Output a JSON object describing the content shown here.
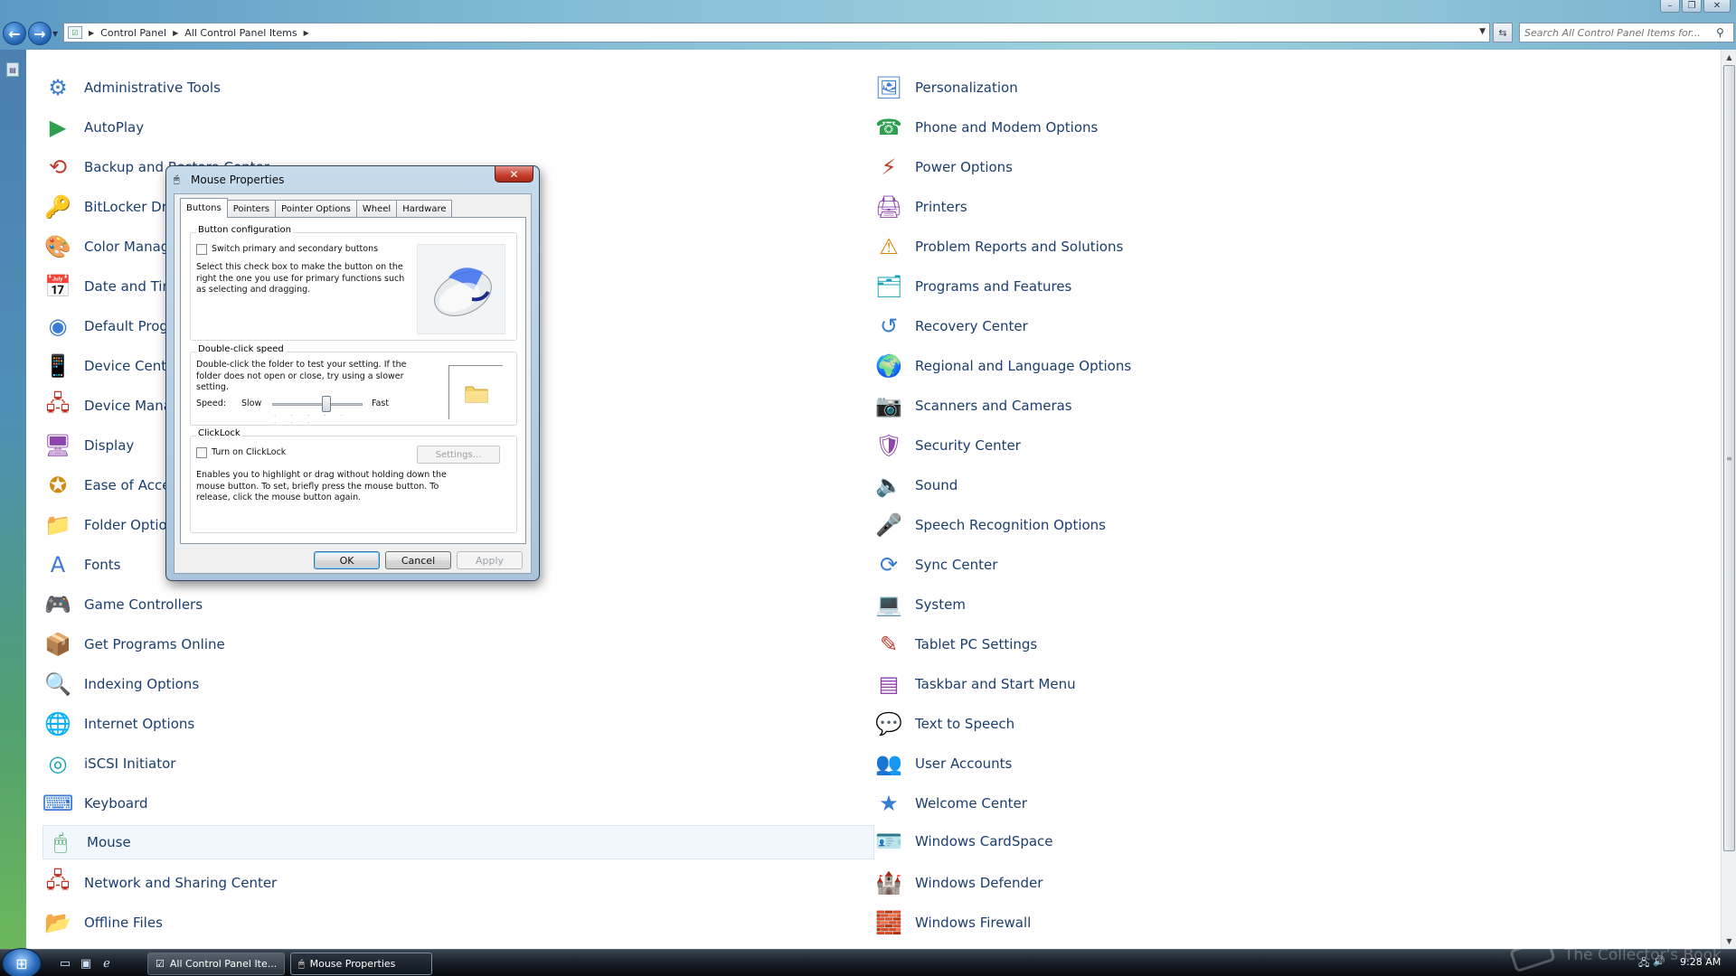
{
  "window": {
    "controls": [
      "minimize",
      "maximize",
      "close"
    ]
  },
  "address_bar": {
    "breadcrumbs": [
      "Control Panel",
      "All Control Panel Items"
    ],
    "search_placeholder": "Search All Control Panel Items for..."
  },
  "control_panel": {
    "left_column": [
      {
        "label": "Administrative Tools",
        "icon": "admin-tools-icon"
      },
      {
        "label": "AutoPlay",
        "icon": "autoplay-icon"
      },
      {
        "label": "Backup and Restore Center",
        "icon": "backup-icon"
      },
      {
        "label": "BitLocker Drive Encryption",
        "icon": "bitlocker-icon"
      },
      {
        "label": "Color Management",
        "icon": "color-management-icon"
      },
      {
        "label": "Date and Time",
        "icon": "date-time-icon"
      },
      {
        "label": "Default Programs",
        "icon": "default-programs-icon"
      },
      {
        "label": "Device Center",
        "icon": "device-center-icon"
      },
      {
        "label": "Device Manager",
        "icon": "device-manager-icon"
      },
      {
        "label": "Display",
        "icon": "display-icon"
      },
      {
        "label": "Ease of Access Center",
        "icon": "ease-of-access-icon"
      },
      {
        "label": "Folder Options",
        "icon": "folder-options-icon"
      },
      {
        "label": "Fonts",
        "icon": "fonts-icon"
      },
      {
        "label": "Game Controllers",
        "icon": "game-controllers-icon"
      },
      {
        "label": "Get Programs Online",
        "icon": "get-programs-icon"
      },
      {
        "label": "Indexing Options",
        "icon": "indexing-icon"
      },
      {
        "label": "Internet Options",
        "icon": "internet-options-icon"
      },
      {
        "label": "iSCSI Initiator",
        "icon": "iscsi-icon"
      },
      {
        "label": "Keyboard",
        "icon": "keyboard-icon"
      },
      {
        "label": "Mouse",
        "icon": "mouse-icon",
        "selected": true
      },
      {
        "label": "Network and Sharing Center",
        "icon": "network-icon"
      },
      {
        "label": "Offline Files",
        "icon": "offline-files-icon"
      }
    ],
    "right_column": [
      {
        "label": "Personalization",
        "icon": "personalization-icon"
      },
      {
        "label": "Phone and Modem Options",
        "icon": "phone-modem-icon"
      },
      {
        "label": "Power Options",
        "icon": "power-options-icon"
      },
      {
        "label": "Printers",
        "icon": "printers-icon"
      },
      {
        "label": "Problem Reports and Solutions",
        "icon": "problem-reports-icon"
      },
      {
        "label": "Programs and Features",
        "icon": "programs-features-icon"
      },
      {
        "label": "Recovery Center",
        "icon": "recovery-icon"
      },
      {
        "label": "Regional and Language Options",
        "icon": "regional-icon"
      },
      {
        "label": "Scanners and Cameras",
        "icon": "scanners-icon"
      },
      {
        "label": "Security Center",
        "icon": "security-center-icon"
      },
      {
        "label": "Sound",
        "icon": "sound-icon"
      },
      {
        "label": "Speech Recognition Options",
        "icon": "speech-recognition-icon"
      },
      {
        "label": "Sync Center",
        "icon": "sync-center-icon"
      },
      {
        "label": "System",
        "icon": "system-icon"
      },
      {
        "label": "Tablet PC Settings",
        "icon": "tablet-pc-icon"
      },
      {
        "label": "Taskbar and Start Menu",
        "icon": "taskbar-icon"
      },
      {
        "label": "Text to Speech",
        "icon": "text-to-speech-icon"
      },
      {
        "label": "User Accounts",
        "icon": "user-accounts-icon"
      },
      {
        "label": "Welcome Center",
        "icon": "welcome-center-icon"
      },
      {
        "label": "Windows CardSpace",
        "icon": "cardspace-icon"
      },
      {
        "label": "Windows Defender",
        "icon": "defender-icon"
      },
      {
        "label": "Windows Firewall",
        "icon": "firewall-icon"
      }
    ]
  },
  "dialog": {
    "title": "Mouse Properties",
    "tabs": [
      "Buttons",
      "Pointers",
      "Pointer Options",
      "Wheel",
      "Hardware"
    ],
    "active_tab": "Buttons",
    "button_config": {
      "title": "Button configuration",
      "checkbox_label": "Switch primary and secondary buttons",
      "checked": false,
      "description": "Select this check box to make the button on the right the one you use for primary functions such as selecting and dragging."
    },
    "double_click": {
      "title": "Double-click speed",
      "description": "Double-click the folder to test your setting. If the folder does not open or close, try using a slower setting.",
      "speed_label": "Speed:",
      "slow_label": "Slow",
      "fast_label": "Fast",
      "slider_value": 0.6
    },
    "clicklock": {
      "title": "ClickLock",
      "checkbox_label": "Turn on ClickLock",
      "checked": false,
      "settings_label": "Settings...",
      "description": "Enables you to highlight or drag without holding down the mouse button. To set, briefly press the mouse button. To release, click the mouse button again."
    },
    "buttons": {
      "ok": "OK",
      "cancel": "Cancel",
      "apply": "Apply"
    }
  },
  "taskbar": {
    "tasks": [
      {
        "label": "All Control Panel Ite...",
        "active": false
      },
      {
        "label": "Mouse Properties",
        "active": true
      }
    ],
    "clock": "9:28 AM",
    "watermark": "The Collector's Book"
  }
}
